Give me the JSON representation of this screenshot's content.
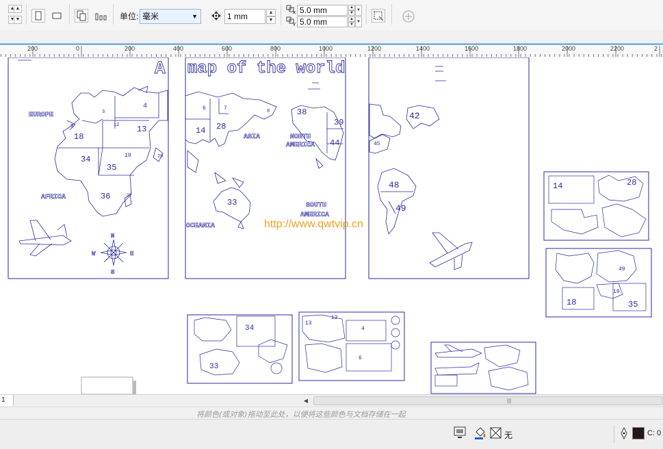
{
  "toolbar": {
    "units_label": "单位:",
    "units_value": "毫米",
    "nudge_value": "1 mm",
    "dup_x": "5.0 mm",
    "dup_y": "5.0 mm"
  },
  "ruler": {
    "ticks": [
      "200",
      "0",
      "200",
      "400",
      "600",
      "800",
      "1000",
      "1200",
      "1400",
      "1600",
      "1800",
      "2000",
      "2200",
      "2"
    ]
  },
  "canvas": {
    "title_left": "A",
    "title_right": "map of the world",
    "watermark": "http://www.qwtvip.cn",
    "labels": {
      "europe": "EUROPE",
      "africa": "AFRICA",
      "asia": "ASIA",
      "oceania": "OCEANIA",
      "north1": "NORTH",
      "north2": "AMERICA",
      "south1": "SOUTH",
      "south2": "AMERICA",
      "compass_n": "N",
      "compass_s": "S",
      "compass_w": "W",
      "compass_e": "E"
    },
    "numbers": {
      "n4": "4",
      "n3": "3",
      "n12": "12",
      "n13": "13",
      "n18": "18",
      "n9": "9",
      "n19": "19",
      "n20": "20",
      "n34": "34",
      "n35": "35",
      "n36": "36",
      "n37": "37",
      "n6": "6",
      "n7": "7",
      "n14": "14",
      "n28": "28",
      "n8": "8",
      "n33": "33",
      "n38": "38",
      "n39": "39",
      "n44": "44",
      "n42": "42",
      "n45": "45",
      "n48": "48",
      "n49": "49"
    },
    "parts": {
      "p14": "14",
      "p28": "28",
      "p18": "18",
      "p19": "19",
      "p35": "35",
      "p49": "49",
      "p34": "34",
      "p33": "33",
      "p13": "13",
      "p12": "12",
      "p4": "4",
      "p6": "6"
    }
  },
  "pages": {
    "current": "1"
  },
  "palette_hint": "将颜色(或对象)拖动至此处，以便将这些颜色与文档存储在一起",
  "status": {
    "fill_none": "无",
    "outline_value": "C: 0"
  },
  "colors": {
    "outline": "#2a2aa0",
    "watermark": "#f0a020",
    "ruler_accent": "#1e88e5"
  }
}
